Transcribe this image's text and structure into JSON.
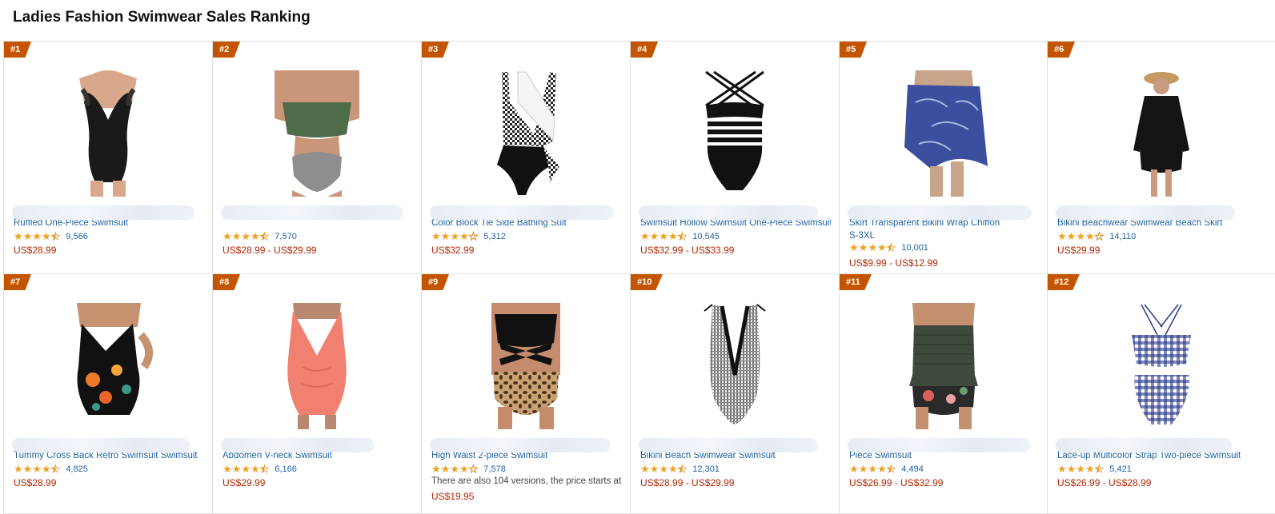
{
  "page": {
    "title": "Ladies Fashion Swimwear Sales Ranking"
  },
  "colors": {
    "badge": "#c45500",
    "link": "#2162a1",
    "price": "#b12704",
    "star": "#f0a020"
  },
  "products": [
    {
      "rank": "#1",
      "title_line1": "",
      "title_line2": "Ruffled One-Piece Swimsuit",
      "rating": 4.5,
      "reviews": "9,566",
      "price": "US$28.99",
      "image_icon": "black-ruffle-one-piece-icon"
    },
    {
      "rank": "#2",
      "title_line1": "",
      "title_line2": "",
      "rating": 4.5,
      "reviews": "7,570",
      "price": "US$28.99 - US$29.99",
      "image_icon": "green-flounce-bikini-icon"
    },
    {
      "rank": "#3",
      "title_line1": "",
      "title_line2": "Color Block Tie Side Bathing Suit",
      "rating": 4.0,
      "reviews": "5,312",
      "price": "US$32.99",
      "image_icon": "gingham-wrap-one-piece-icon"
    },
    {
      "rank": "#4",
      "title_line1": "",
      "title_line2": "Swimsuit Hollow Swimsuit One-Piece Swimsuit",
      "rating": 4.5,
      "reviews": "10,545",
      "price": "US$32.99 - US$33.99",
      "image_icon": "black-strappy-one-piece-icon"
    },
    {
      "rank": "#5",
      "title_line1": "",
      "title_line2": "Skirt Transparent Bikini Wrap Chiffon",
      "title_line3": "S-3XL",
      "rating": 4.5,
      "reviews": "10,001",
      "price": "US$9.99 - US$12.99",
      "image_icon": "blue-sarong-icon"
    },
    {
      "rank": "#6",
      "title_line1": "",
      "title_line2": "Bikini Beachwear Swimwear Beach Skirt",
      "rating": 4.0,
      "reviews": "14,110",
      "price": "US$29.99",
      "image_icon": "black-cover-up-icon"
    },
    {
      "rank": "#7",
      "title_line1": "",
      "title_line2": "Tummy Cross Back Retro Swimsuit Swimsuit",
      "rating": 4.5,
      "reviews": "4,825",
      "price": "US$28.99",
      "image_icon": "floral-halter-one-piece-icon"
    },
    {
      "rank": "#8",
      "title_line1": "",
      "title_line2": "Abdomen V-neck Swimsuit",
      "rating": 4.5,
      "reviews": "6,166",
      "price": "US$29.99",
      "image_icon": "coral-v-neck-one-piece-icon"
    },
    {
      "rank": "#9",
      "title_line1": "",
      "title_line2": "High Waist 2-piece Swimsuit",
      "rating": 4.0,
      "reviews": "7,578",
      "note": "There are also 104 versions, the price starts at",
      "price": "US$19.95",
      "image_icon": "leopard-high-waist-bikini-icon"
    },
    {
      "rank": "#10",
      "title_line1": "",
      "title_line2": "Bikini Beach Swimwear Swimsuit",
      "rating": 4.5,
      "reviews": "12,301",
      "price": "US$28.99 - US$29.99",
      "image_icon": "gingham-plunge-one-piece-icon"
    },
    {
      "rank": "#11",
      "title_line1": "",
      "title_line2": "Piece Swimsuit",
      "rating": 4.5,
      "reviews": "4,494",
      "price": "US$26.99 - US$32.99",
      "image_icon": "smocked-tankini-icon"
    },
    {
      "rank": "#12",
      "title_line1": "",
      "title_line2": "Lace-up Multicolor Strap Two-piece Swimsuit",
      "rating": 4.5,
      "reviews": "5,421",
      "price": "US$26.99 - US$28.99",
      "image_icon": "blue-gingham-bikini-icon"
    }
  ]
}
